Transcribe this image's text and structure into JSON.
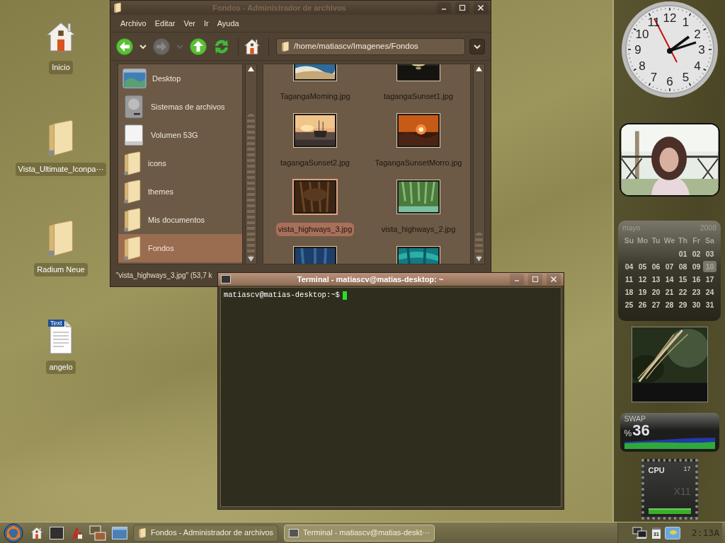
{
  "desktop_icons": [
    {
      "label": "Inicio",
      "kind": "home"
    },
    {
      "label": "Vista_Ultimate_Iconpa···",
      "kind": "folder"
    },
    {
      "label": "Radium Neue",
      "kind": "folder"
    },
    {
      "label": "angelo",
      "kind": "text",
      "badge": "Text"
    }
  ],
  "file_manager": {
    "title": "Fondos - Administrador de archivos",
    "active": false,
    "menu": [
      "Archivo",
      "Editar",
      "Ver",
      "Ir",
      "Ayuda"
    ],
    "toolbar": [
      {
        "buttons": [
          {
            "kind": "back",
            "disabled": false
          },
          {
            "kind": "dropdown",
            "disabled": false
          },
          {
            "kind": "forward",
            "disabled": true
          },
          {
            "kind": "dropdown",
            "disabled": true
          },
          {
            "kind": "up",
            "disabled": false
          },
          {
            "kind": "reload",
            "disabled": false
          }
        ]
      },
      {
        "buttons": [
          {
            "kind": "home",
            "disabled": false
          }
        ]
      }
    ],
    "location": "/home/matiascv/Imagenes/Fondos",
    "sidebar": [
      {
        "label": "Desktop",
        "kind": "desktop",
        "selected": false
      },
      {
        "label": "Sistemas de archivos",
        "kind": "drive",
        "selected": false
      },
      {
        "label": "Volumen 53G",
        "kind": "volume",
        "selected": false
      },
      {
        "label": "icons",
        "kind": "folder",
        "selected": false
      },
      {
        "label": "themes",
        "kind": "folder",
        "selected": false
      },
      {
        "label": "Mis documentos",
        "kind": "folder",
        "selected": false
      },
      {
        "label": "Fondos",
        "kind": "folder",
        "selected": true
      }
    ],
    "files": [
      {
        "name": "TagangaMoming.jpg",
        "selected": false
      },
      {
        "name": "tagangaSunset1.jpg",
        "selected": false
      },
      {
        "name": "tagangaSunset2.jpg",
        "selected": false
      },
      {
        "name": "TagangaSunsetMorro.jpg",
        "selected": false
      },
      {
        "name": "vista_highways_3.jpg",
        "selected": true
      },
      {
        "name": "vista_highways_2.jpg",
        "selected": false
      },
      {
        "selected": false
      },
      {
        "selected": false
      }
    ],
    "status": "\"vista_highways_3.jpg\" (53,7 k"
  },
  "terminal": {
    "title": "Terminal - matiascv@matias-desktop: ~",
    "active": true,
    "prompt": "matiascv@matias-desktop:~$"
  },
  "widgets": {
    "clock": {
      "numerals": [
        "12",
        "11",
        "1",
        "10",
        "2",
        "9",
        "3",
        "8",
        "4",
        "7",
        "5",
        "6"
      ]
    },
    "calendar": {
      "month": "mayo",
      "year": "2008",
      "weekdays": [
        "Su",
        "Mo",
        "Tu",
        "We",
        "Th",
        "Fr",
        "Sa"
      ],
      "weeks": [
        [
          {
            "day": "01",
            "selected": false
          },
          {
            "day": "02",
            "selected": false
          },
          {
            "day": "03",
            "selected": false
          }
        ],
        [
          {
            "day": "04",
            "selected": false
          },
          {
            "day": "05",
            "selected": false
          },
          {
            "day": "06",
            "selected": false
          },
          {
            "day": "07",
            "selected": false
          },
          {
            "day": "08",
            "selected": false
          },
          {
            "day": "09",
            "selected": false
          },
          {
            "day": "10",
            "selected": true
          }
        ],
        [
          {
            "day": "11",
            "selected": false
          },
          {
            "day": "12",
            "selected": false
          },
          {
            "day": "13",
            "selected": false
          },
          {
            "day": "14",
            "selected": false
          },
          {
            "day": "15",
            "selected": false
          },
          {
            "day": "16",
            "selected": false
          },
          {
            "day": "17",
            "selected": false
          }
        ],
        [
          {
            "day": "18",
            "selected": false
          },
          {
            "day": "19",
            "selected": false
          },
          {
            "day": "20",
            "selected": false
          },
          {
            "day": "21",
            "selected": false
          },
          {
            "day": "22",
            "selected": false
          },
          {
            "day": "23",
            "selected": false
          },
          {
            "day": "24",
            "selected": false
          }
        ],
        [
          {
            "day": "25",
            "selected": false
          },
          {
            "day": "26",
            "selected": false
          },
          {
            "day": "27",
            "selected": false
          },
          {
            "day": "28",
            "selected": false
          },
          {
            "day": "29",
            "selected": false
          },
          {
            "day": "30",
            "selected": false
          },
          {
            "day": "31",
            "selected": false
          }
        ]
      ]
    },
    "swap": {
      "label": "SWAP",
      "unit": "%",
      "value": "36"
    },
    "cpu": {
      "label": "CPU",
      "value": "17",
      "host": "X11"
    }
  },
  "taskbar": {
    "launchers": [
      {
        "kind": "start"
      },
      {
        "kind": "home"
      },
      {
        "kind": "terminal"
      },
      {
        "kind": "tool"
      },
      {
        "kind": "switcher"
      },
      {
        "kind": "desktop"
      }
    ],
    "tasks": [
      {
        "label": "Fondos - Administrador de archivos",
        "kind": "folder",
        "selected": false
      },
      {
        "label": "Terminal - matiascv@matias-deskt···",
        "kind": "terminal",
        "selected": true
      }
    ],
    "tray": [
      {
        "kind": "network"
      },
      {
        "kind": "calendar",
        "text": "31"
      },
      {
        "kind": "picture"
      }
    ],
    "clock": "2:13A"
  }
}
